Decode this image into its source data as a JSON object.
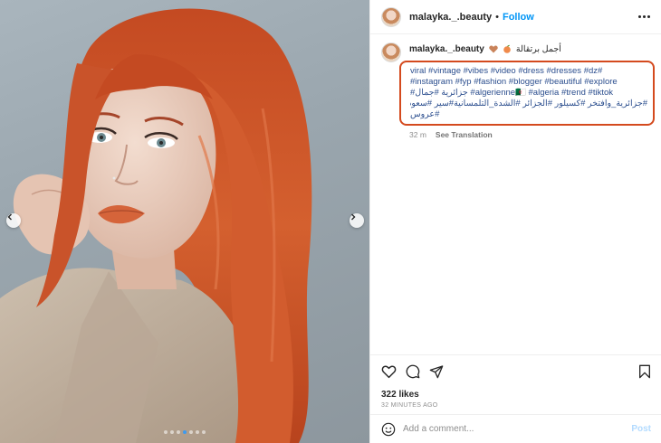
{
  "post": {
    "username": "malayka._.beauty",
    "dot": "•",
    "follow_label": "Follow"
  },
  "caption": {
    "username": "malayka._.beauty",
    "text": "أجمل برتقالة",
    "emojis": [
      "brown-heart",
      "peach"
    ],
    "hashtag_lines": [
      "viral #vintage #vibes #video #dress #dresses #dz#",
      "#instagram #fyp #fashion #blogger #beautiful #explore",
      "#جزائرية #جمال #algerienne🇩🇿 #algeria #trend #tiktok",
      "#جزائرية_وافتخر #كسيلور #الجزائر #الشدة_التلمسانية#سير #سعودية #حب #عروض",
      "#عروس"
    ],
    "time_ago": "32 m",
    "see_translation": "See Translation"
  },
  "engagement": {
    "likes": "322 likes",
    "time": "32 MINUTES AGO"
  },
  "comment": {
    "placeholder": "Add a comment...",
    "post_label": "Post"
  },
  "carousel": {
    "slide_count": 7,
    "active_index": 3
  },
  "colors": {
    "accent_follow": "#0095f6",
    "highlight_border": "#d44a1e",
    "hashtag": "#2b4e8e",
    "hair": "#c8512a"
  },
  "icons": [
    "heart-icon",
    "comment-icon",
    "share-icon",
    "bookmark-icon",
    "emoji-icon",
    "more-icon",
    "chevron-left-icon",
    "chevron-right-icon"
  ]
}
